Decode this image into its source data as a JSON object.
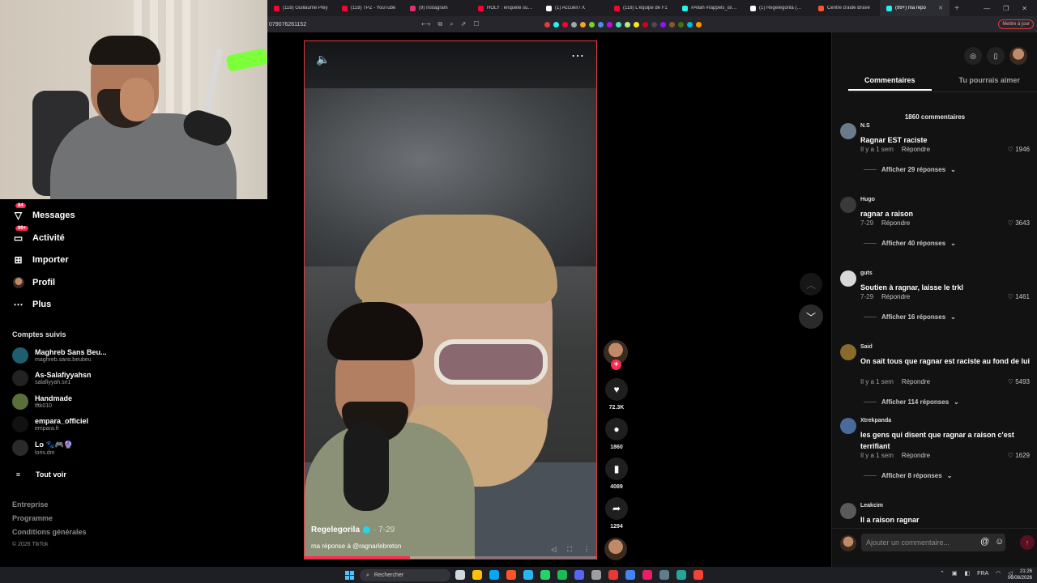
{
  "browser": {
    "tabs": [
      {
        "label": "(118) Guillaume Pley",
        "color": "#ff0033"
      },
      {
        "label": "(118) TPZ - YouTube",
        "color": "#ff0033"
      },
      {
        "label": "(9) Instagram",
        "color": "#e1306c"
      },
      {
        "label": "HOLY : enquête sur la",
        "color": "#ff0033"
      },
      {
        "label": "(1) Accueil / X",
        "color": "#ffffff"
      },
      {
        "label": "(118) L'équipe de F1",
        "color": "#ff0033"
      },
      {
        "label": "#Allah #rappels_islam",
        "color": "#25f4ee"
      },
      {
        "label": "(1) Regelegorila (@re",
        "color": "#ffffff"
      },
      {
        "label": "Centre d'aide Brave",
        "color": "#fb542b"
      },
      {
        "label": "(99+) ma répo",
        "color": "#25f4ee",
        "active": true
      }
    ],
    "new_tab": "+",
    "window_controls": [
      "—",
      "❐",
      "✕"
    ],
    "url": "079076261152",
    "update_button": "Mettre à jour"
  },
  "sidebar": {
    "items": [
      {
        "label": "Messages",
        "icon": "paper-plane-icon",
        "badge": "84"
      },
      {
        "label": "Activité",
        "icon": "inbox-icon",
        "badge": "99+"
      },
      {
        "label": "Importer",
        "icon": "plus-square-icon",
        "badge": ""
      },
      {
        "label": "Profil",
        "icon": "avatar-icon",
        "badge": ""
      },
      {
        "label": "Plus",
        "icon": "ellipsis-icon",
        "badge": ""
      }
    ],
    "followed_title": "Comptes suivis",
    "accounts": [
      {
        "name": "Maghreb Sans Beu...",
        "handle": "maghreb.sans.beubeu",
        "color": "#1f5e6e"
      },
      {
        "name": "As-Salafiyyahsn",
        "handle": "salafiyyah.sn1",
        "color": "#222222"
      },
      {
        "name": "Handmade",
        "handle": "tftk010",
        "color": "#5b6f3a"
      },
      {
        "name": "empara_officiel",
        "handle": "empara.fr",
        "color": "#111111"
      },
      {
        "name": "Lo 🐾🎮🔮",
        "handle": "loris.dm",
        "color": "#2b2b2b"
      }
    ],
    "see_all": "Tout voir",
    "footer": [
      "Entreprise",
      "Programme",
      "Conditions générales"
    ],
    "copyright": "© 2026 TikTok"
  },
  "video": {
    "author": "Regelegorila",
    "date": "· 7-29",
    "caption": "ma réponse à @ragnarlebreton",
    "progress": 0.36
  },
  "actions": {
    "likes": "72.3K",
    "comments": "1860",
    "saves": "4089",
    "shares": "1294"
  },
  "comments_panel": {
    "tab_comments": "Commentaires",
    "tab_like": "Tu pourrais aimer",
    "count": "1860 commentaires",
    "items": [
      {
        "user": "N.S",
        "text": "Ragnar EST raciste",
        "time": "Il y a 1 sem",
        "reply": "Répondre",
        "likes": "1946",
        "more": "Afficher 29 réponses",
        "color": "#6b7b8c"
      },
      {
        "user": "Hugo",
        "text": "ragnar a raison",
        "time": "7-29",
        "reply": "Répondre",
        "likes": "3643",
        "more": "Afficher 40 réponses",
        "color": "#3a3a3a"
      },
      {
        "user": "guts",
        "text": "Soutien à ragnar, laisse le trkl",
        "time": "7-29",
        "reply": "Répondre",
        "likes": "1461",
        "more": "Afficher 16 réponses",
        "color": "#d8d8d8"
      },
      {
        "user": "Said",
        "text": "On sait tous que ragnar est raciste au fond de lui",
        "time": "Il y a 1 sem",
        "reply": "Répondre",
        "likes": "5493",
        "more": "Afficher 114 réponses",
        "color": "#8a6a2a"
      },
      {
        "user": "Xtrekpanda",
        "text": "les gens qui disent que ragnar a raison c'est terrifiant",
        "time": "Il y a 1 sem",
        "reply": "Répondre",
        "likes": "1629",
        "more": "Afficher 8 réponses",
        "color": "#4a6a9a"
      },
      {
        "user": "Leakcim",
        "text": "Il a raison ragnar",
        "time": "",
        "reply": "",
        "likes": "",
        "more": "",
        "color": "#5a5a5a"
      }
    ],
    "input_placeholder": "Ajouter un commentaire..."
  },
  "taskbar": {
    "search": "Rechercher",
    "lang": "FRA",
    "time": "21:26",
    "date": "06/08/2026"
  }
}
